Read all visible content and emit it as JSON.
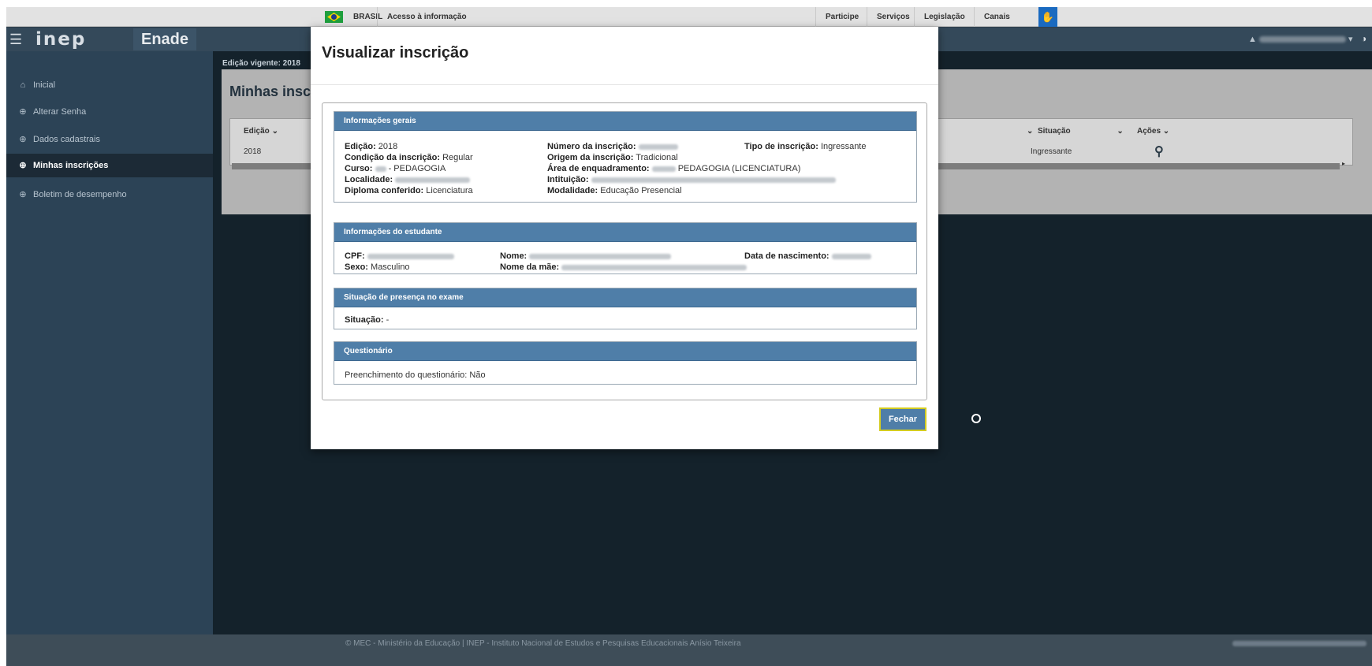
{
  "govbar": {
    "country": "BRASIL",
    "access": "Acesso à informação",
    "participe": "Participe",
    "servicos": "Serviços",
    "legislacao": "Legislação",
    "canais": "Canais"
  },
  "header": {
    "logo": "inep",
    "app": "Enade"
  },
  "sidebar": {
    "items": [
      {
        "label": "Inicial",
        "icon": "home-icon",
        "active": false
      },
      {
        "label": "Alterar Senha",
        "icon": "circle-plus-icon",
        "active": false
      },
      {
        "label": "Dados cadastrais",
        "icon": "circle-plus-icon",
        "active": false
      },
      {
        "label": "Minhas inscrições",
        "icon": "circle-plus-icon",
        "active": true
      },
      {
        "label": "Boletim de desempenho",
        "icon": "circle-plus-icon",
        "active": false
      }
    ]
  },
  "content": {
    "edicao_vigente": "Edição vigente: 2018",
    "title": "Minhas inscrições",
    "grid": {
      "headers": [
        "Edição",
        "Situação",
        "Ações"
      ],
      "row": {
        "edicao": "2018",
        "situacao": "Ingressante"
      }
    }
  },
  "modal": {
    "title": "Visualizar inscrição",
    "sections": {
      "gerais": {
        "title": "Informações gerais",
        "edicao_label": "Edição:",
        "edicao_value": "2018",
        "numero_label": "Número da inscrição:",
        "tipo_label": "Tipo de inscrição:",
        "tipo_value": "Ingressante",
        "condicao_label": "Condição da inscrição:",
        "condicao_value": "Regular",
        "origem_label": "Origem da inscrição:",
        "origem_value": "Tradicional",
        "curso_label": "Curso:",
        "curso_value": "- PEDAGOGIA",
        "area_label": "Área de enquadramento:",
        "area_value": "PEDAGOGIA (LICENCIATURA)",
        "localidade_label": "Localidade:",
        "instituicao_label": "Intituição:",
        "diploma_label": "Diploma conferido:",
        "diploma_value": "Licenciatura",
        "modalidade_label": "Modalidade:",
        "modalidade_value": "Educação Presencial"
      },
      "estudante": {
        "title": "Informações do estudante",
        "cpf_label": "CPF:",
        "nome_label": "Nome:",
        "nascimento_label": "Data de nascimento:",
        "sexo_label": "Sexo:",
        "sexo_value": "Masculino",
        "mae_label": "Nome da mãe:"
      },
      "presenca": {
        "title": "Situação de presença no exame",
        "situacao_label": "Situação:",
        "situacao_value": "-"
      },
      "questionario": {
        "title": "Questionário",
        "preench_label": "Preenchimento do questionário:",
        "preench_value": "Não"
      }
    },
    "close_label": "Fechar"
  },
  "footer": {
    "copyright": "© MEC - Ministério da Educação | INEP - Instituto Nacional de Estudos e Pesquisas Educacionais Anísio Teixeira"
  }
}
